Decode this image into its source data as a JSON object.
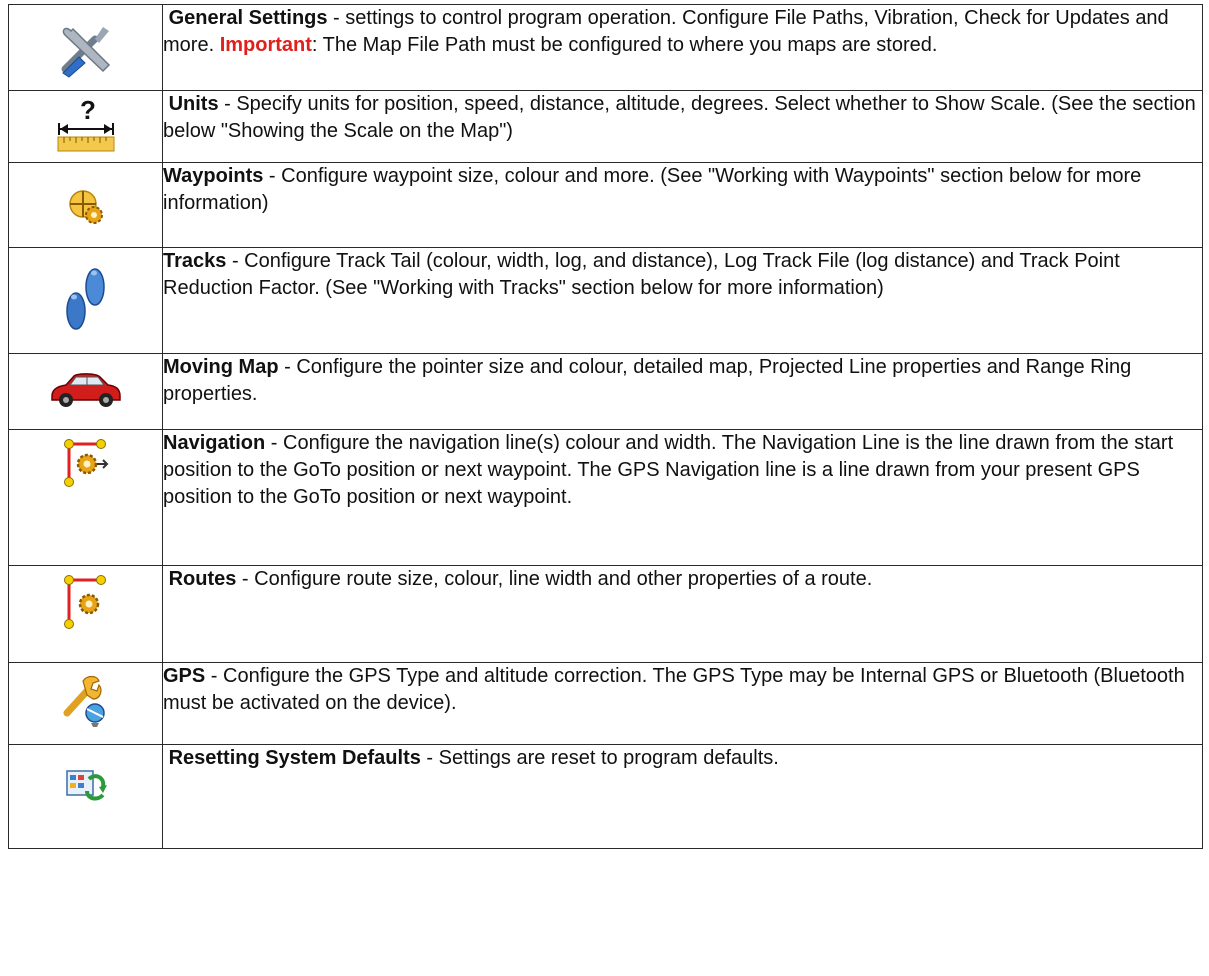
{
  "rows": [
    {
      "icon": "tools-icon",
      "title": "General Settings",
      "desc": " - settings to control program operation. Configure File Paths, Vibration, Check for Updates and more.  ",
      "important": "Important",
      "desc_after": ": The Map File Path must be configured to where you maps are stored."
    },
    {
      "icon": "units-ruler-icon",
      "title": "Units",
      "desc": " - Specify units for position, speed, distance, altitude, degrees. Select whether to Show Scale. (See the section below \"Showing the Scale on the Map\")"
    },
    {
      "icon": "waypoint-gear-icon",
      "title": "Waypoints",
      "desc": " - Configure waypoint size, colour and more. (See \"Working with Waypoints\" section below for more information)"
    },
    {
      "icon": "footprints-icon",
      "title": "Tracks",
      "desc": " - Configure Track Tail (colour, width, log, and distance), Log Track File (log distance) and Track Point Reduction Factor. (See \"Working with Tracks\" section below for more information)"
    },
    {
      "icon": "red-car-icon",
      "title": "Moving Map",
      "desc": " - Configure the pointer size and colour, detailed map, Projected Line properties and Range Ring properties."
    },
    {
      "icon": "navigation-route-gear-icon",
      "title": "Navigation",
      "desc": " - Configure the navigation line(s) colour and width. The Navigation Line is the line drawn from the start position to the GoTo position or next waypoint. The GPS Navigation line is a line drawn from your present GPS position to the GoTo position or next waypoint."
    },
    {
      "icon": "route-gear-icon",
      "title": "Routes",
      "desc": " - Configure route size, colour, line width and other properties of a route."
    },
    {
      "icon": "wrench-satellite-icon",
      "title": "GPS",
      "desc": " - Configure the GPS Type and altitude correction.  The GPS Type may be Internal GPS or Bluetooth (Bluetooth must be activated on the device)."
    },
    {
      "icon": "reset-defaults-icon",
      "title": "Resetting System Defaults",
      "desc": " - Settings are reset to program defaults."
    }
  ]
}
